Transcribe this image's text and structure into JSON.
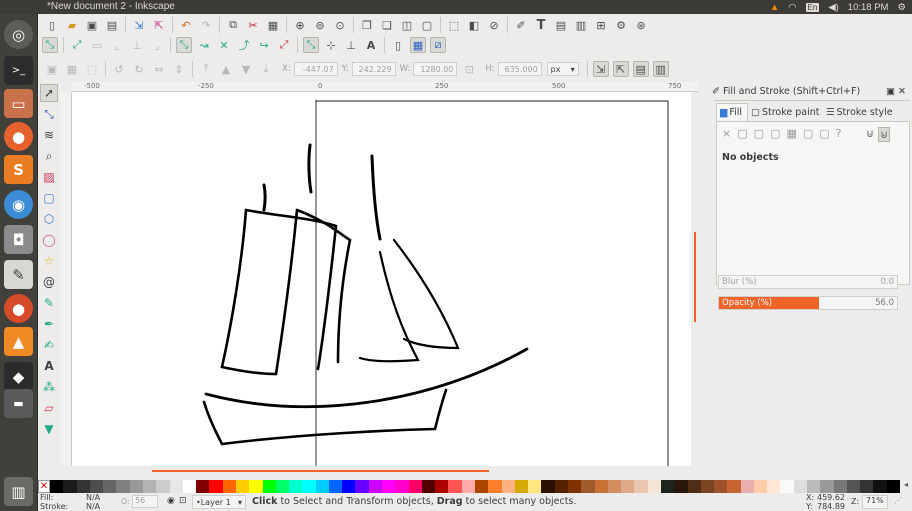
{
  "window": {
    "title": "*New document 2 - Inkscape"
  },
  "tray": {
    "keyboard": "En",
    "time": "10:18 PM"
  },
  "launcher": {
    "items": [
      "ubuntu-dash-icon",
      "terminal-icon",
      "browser-window-icon",
      "firefox-icon",
      "sublime-text-icon",
      "chromium-icon",
      "camera-icon",
      "text-editor-icon",
      "firefox-dev-icon",
      "vlc-icon",
      "inkscape-icon",
      "files-icon",
      "trash-icon"
    ]
  },
  "toolbar3": {
    "x_label": "X:",
    "x_value": "-447.07",
    "y_label": "Y:",
    "y_value": "242.229",
    "w_label": "W:",
    "w_value": "1280.00",
    "h_label": "H:",
    "h_value": "635.000",
    "unit": "px"
  },
  "ruler": {
    "ticks": [
      "-500",
      "-250",
      "0",
      "250",
      "500",
      "750"
    ]
  },
  "panel": {
    "title": "Fill and Stroke (Shift+Ctrl+F)",
    "tabs": [
      "Fill",
      "Stroke paint",
      "Stroke style"
    ],
    "no_objects": "No objects",
    "blur_label": "Blur (%)",
    "blur_value": "0.0",
    "opacity_label": "Opacity (%)",
    "opacity_value": "56.0",
    "opacity_fraction": 0.56
  },
  "status": {
    "fill_label": "Fill:",
    "fill_value": "N/A",
    "stroke_label": "Stroke:",
    "stroke_value": "N/A",
    "o_label": "O:",
    "o_value": "56",
    "layer": "•Layer 1",
    "message_bold1": "Click",
    "message_mid": " to Select and Transform objects, ",
    "message_bold2": "Drag",
    "message_end": " to select many objects.",
    "x_label": "X:",
    "x_coord": "459.62",
    "y_label": "Y:",
    "y_coord": "784.89",
    "z_label": "Z:",
    "zoom": "71%"
  },
  "palette": [
    "#000000",
    "#1a1a1a",
    "#333333",
    "#4d4d4d",
    "#666666",
    "#808080",
    "#999999",
    "#b3b3b3",
    "#cccccc",
    "#e6e6e6",
    "#ffffff",
    "#800000",
    "#ff0000",
    "#ff6600",
    "#ffcc00",
    "#ffff00",
    "#00ff00",
    "#00ff66",
    "#00ffcc",
    "#00ffff",
    "#00ccff",
    "#0066ff",
    "#0000ff",
    "#6600ff",
    "#cc00ff",
    "#ff00ff",
    "#ff00cc",
    "#ff0066",
    "#550000",
    "#aa0000",
    "#ff5555",
    "#ffaaaa",
    "#aa4400",
    "#ff7f2a",
    "#ffb380",
    "#d4aa00",
    "#ffe680",
    "#2b1100",
    "#552200",
    "#803300",
    "#a05a2c",
    "#c87137",
    "#d38d5f",
    "#deaa87",
    "#e9c6af",
    "#f4e3d7",
    "#1c241c",
    "#28170b",
    "#502d16",
    "#784421",
    "#a0522d",
    "#c86432",
    "#e9afaf",
    "#ffccaa",
    "#ffe6d5",
    "#f9f9f9",
    "#dddddd",
    "#bbbbbb",
    "#999999",
    "#777777",
    "#555555",
    "#333333",
    "#111111",
    "#000000"
  ]
}
